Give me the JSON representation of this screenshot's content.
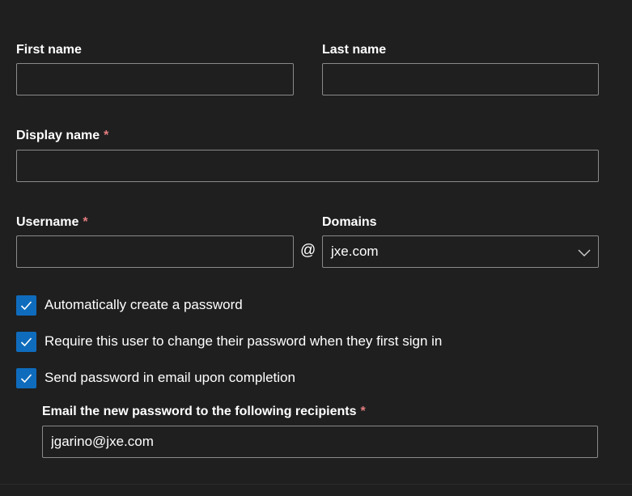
{
  "form": {
    "first_name": {
      "label": "First name",
      "value": ""
    },
    "last_name": {
      "label": "Last name",
      "value": ""
    },
    "display_name": {
      "label": "Display name",
      "required_mark": "*",
      "value": ""
    },
    "username": {
      "label": "Username",
      "required_mark": "*",
      "value": ""
    },
    "at_sign": "@",
    "domains": {
      "label": "Domains",
      "selected": "jxe.com"
    },
    "options": [
      {
        "label": "Automatically create a password",
        "checked": true
      },
      {
        "label": "Require this user to change their password when they first sign in",
        "checked": true
      },
      {
        "label": "Send password in email upon completion",
        "checked": true
      }
    ],
    "recipients": {
      "label": "Email the new password to the following recipients",
      "required_mark": "*",
      "value": "jgarino@jxe.com"
    }
  },
  "colors": {
    "background": "#1f1f1f",
    "field_border": "#8a8a8a",
    "checkbox_fill": "#0f6cbd",
    "required_asterisk": "#e37d80"
  },
  "icons": {
    "checkbox": "checkmark-icon",
    "dropdown": "chevron-down-icon"
  }
}
